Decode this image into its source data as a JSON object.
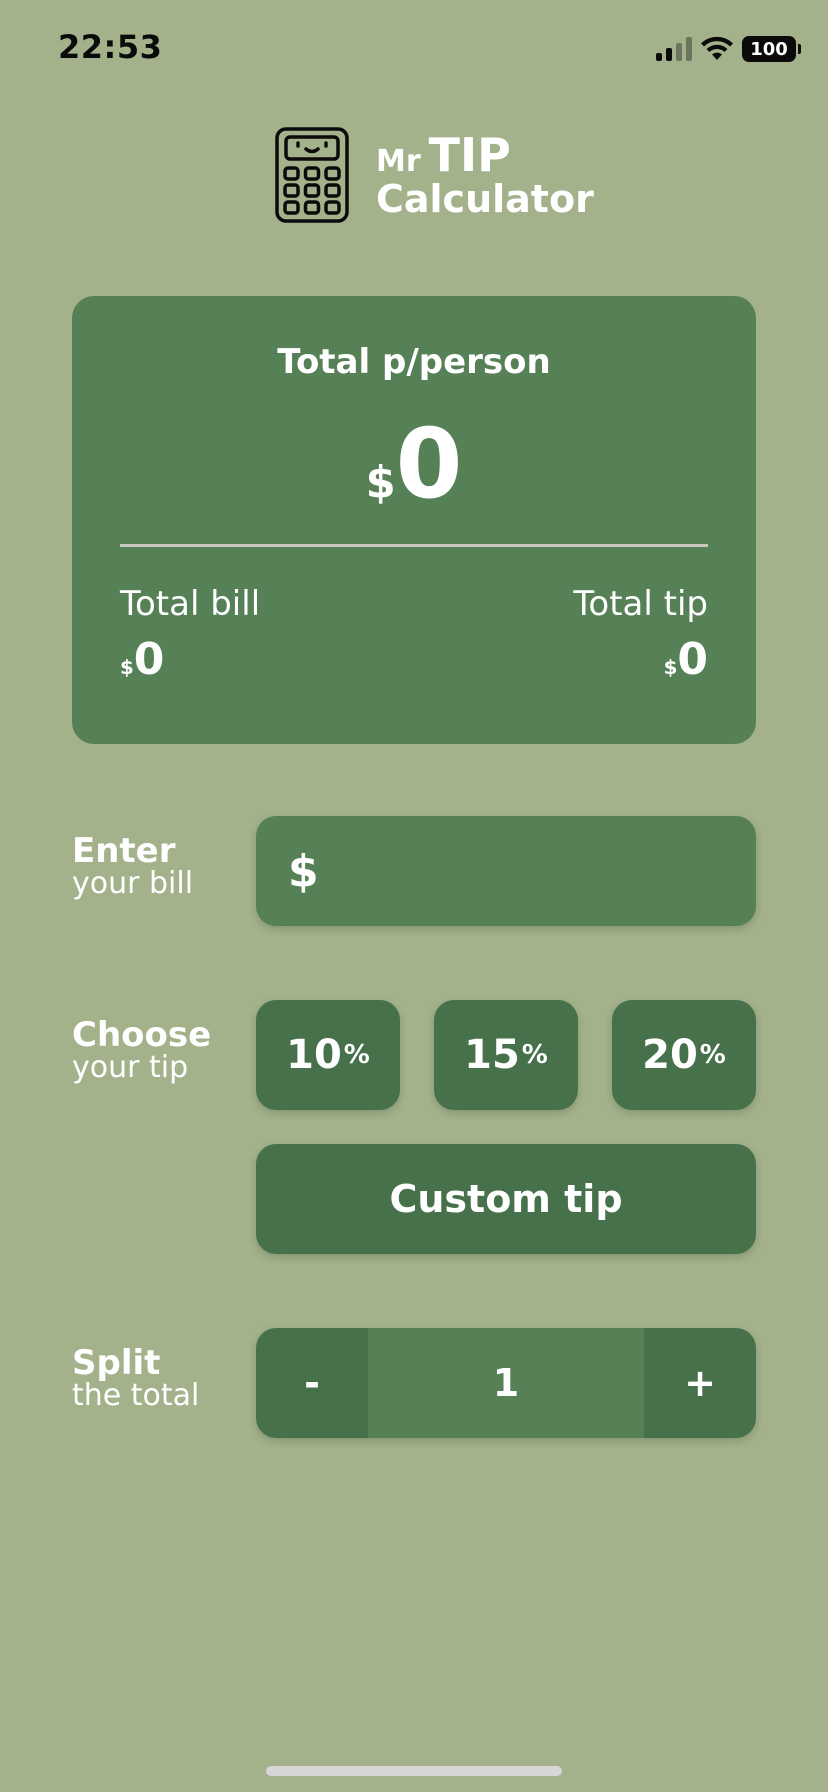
{
  "status_bar": {
    "time": "22:53",
    "battery": "100"
  },
  "logo": {
    "prefix": "Mr",
    "highlight": "TIP",
    "subtitle": "Calculator"
  },
  "summary": {
    "heading": "Total p/person",
    "currency": "$",
    "per_person": "0",
    "total_bill_label": "Total bill",
    "total_bill": "0",
    "total_tip_label": "Total tip",
    "total_tip": "0"
  },
  "bill_section": {
    "title": "Enter",
    "subtitle": "your bill",
    "currency": "$",
    "value": ""
  },
  "tip_section": {
    "title": "Choose",
    "subtitle": "your tip",
    "options": [
      {
        "value": "10",
        "unit": "%"
      },
      {
        "value": "15",
        "unit": "%"
      },
      {
        "value": "20",
        "unit": "%"
      }
    ],
    "custom_label": "Custom tip"
  },
  "split_section": {
    "title": "Split",
    "subtitle": "the total",
    "decrement": "-",
    "count": "1",
    "increment": "+"
  }
}
